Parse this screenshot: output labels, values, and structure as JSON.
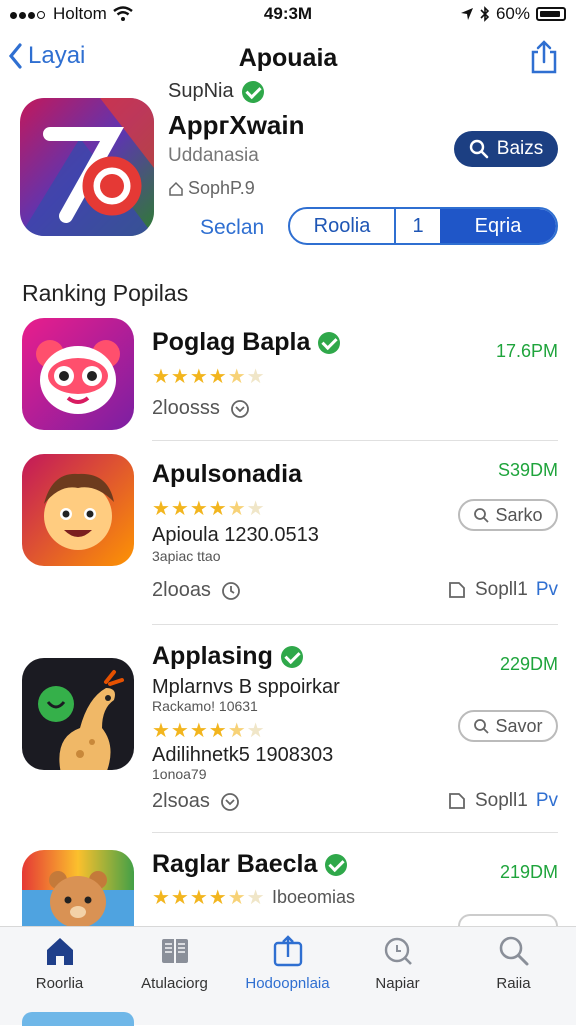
{
  "status_bar": {
    "carrier": "Holtom",
    "time": "49:3M",
    "battery": "60%"
  },
  "nav": {
    "back_label": "Layai",
    "title": "Apouaia"
  },
  "header_app": {
    "developer": "SupNia",
    "name": "AppгXwain",
    "category": "Uddanasia",
    "size": "SophP.9",
    "action_label": "Baizs",
    "link_label": "Seclan",
    "segments": [
      "Roolia",
      "1",
      "Eqria"
    ]
  },
  "section_title": "Ranking Popilas",
  "apps": [
    {
      "name": "Poglag Bapla",
      "verified": true,
      "rating": 4.5,
      "downloads": "2loosss",
      "price": "17.6PM"
    },
    {
      "name": "Apulsonadia",
      "verified": false,
      "rating": 4.5,
      "subtitle": "Apioula 1230.0513",
      "subtitle2": "3apiac ttao",
      "downloads": "2looas",
      "price": "S39DM",
      "button_label": "Sarko",
      "side_label": "Sopll1",
      "side_accent": "Pv"
    },
    {
      "name": "Applasing",
      "verified": true,
      "rating": 4.5,
      "subtitle": "Mplarnvs B sppoirkar",
      "subtitle2": "Rackamo! 10631",
      "subtitle3": "Adilihnetk5 1908303",
      "subtitle4": "1onoa79",
      "downloads": "2lsoas",
      "price": "229DM",
      "button_label": "Savor",
      "side_label": "Sopll1",
      "side_accent": "Pv"
    },
    {
      "name": "Raglar Baecla",
      "verified": true,
      "rating": 4.5,
      "subtitle": "Iboeomias",
      "price": "219DM"
    }
  ],
  "tabs": [
    {
      "label": "Roorlia",
      "icon": "home-icon"
    },
    {
      "label": "Atulaciorg",
      "icon": "book-icon"
    },
    {
      "label": "Hodoopnlaia",
      "icon": "share-icon",
      "active": true
    },
    {
      "label": "Napiar",
      "icon": "magnify-icon"
    },
    {
      "label": "Raiia",
      "icon": "search-icon"
    }
  ],
  "colors": {
    "accent": "#2f6fd1",
    "price_green": "#1fa43c",
    "star": "#f2b51e",
    "dark_button": "#1c3f82"
  }
}
